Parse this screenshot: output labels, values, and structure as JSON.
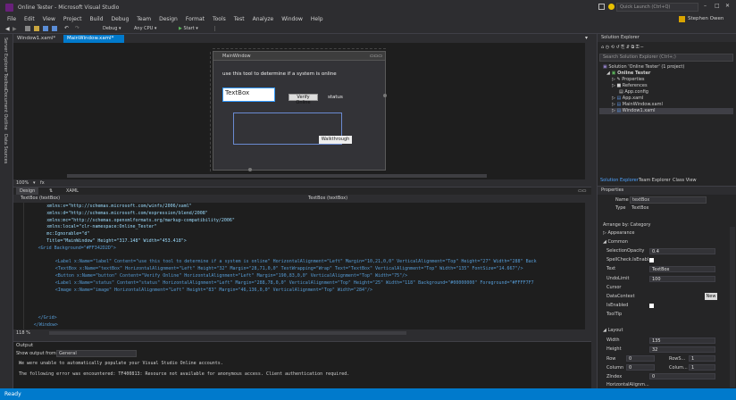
{
  "window": {
    "title": "Online Tester - Microsoft Visual Studio",
    "quick_launch": "Quick Launch (Ctrl+Q)",
    "user": "Stephen Owen"
  },
  "menu": [
    "File",
    "Edit",
    "View",
    "Project",
    "Build",
    "Debug",
    "Team",
    "Design",
    "Format",
    "Tools",
    "Test",
    "Analyze",
    "Window",
    "Help"
  ],
  "toolbar": {
    "config": "Debug",
    "platform": "Any CPU",
    "start": "Start"
  },
  "doc_tabs": [
    "Window1.xaml*",
    "MainWindow.xaml*"
  ],
  "left_strip": [
    "Server Explorer",
    "Toolbox",
    "Document Outline",
    "Data Sources"
  ],
  "designer": {
    "window_title": "MainWindow",
    "label_text": "use this tool to determine if a system is online",
    "textbox_text": "TextBox",
    "verify_button": "Verify Online",
    "status_label": "status",
    "walkthrough_label": "Walkthrough"
  },
  "zoom": "100%",
  "split_tabs": {
    "design": "Design",
    "xaml": "XAML"
  },
  "xaml_path": {
    "left": "TextBox (textBox)",
    "right": "TextBox (textBox)"
  },
  "code_lines": [
    "xmlns:x=\"http://schemas.microsoft.com/winfx/2006/xaml\"",
    "xmlns:d=\"http://schemas.microsoft.com/expression/blend/2008\"",
    "xmlns:mc=\"http://schemas.openxmlformats.org/markup-compatibility/2006\"",
    "xmlns:local=\"clr-namespace:Online_Tester\"",
    "mc:Ignorable=\"d\"",
    "Title=\"MainWindow\" Height=\"317.148\" Width=\"453.418\">",
    "<Grid Background=\"#FF342D2D\">",
    "",
    "<Label x:Name=\"label\" Content=\"use this tool to determine if a system is online\" HorizontalAlignment=\"Left\" Margin=\"10,21,0,0\" VerticalAlignment=\"Top\" Height=\"27\" Width=\"288\" Back",
    "<TextBox x:Name=\"textBox\" HorizontalAlignment=\"Left\" Height=\"32\" Margin=\"28,71,0,0\" TextWrapping=\"Wrap\" Text=\"TextBox\" VerticalAlignment=\"Top\" Width=\"135\" FontSize=\"14.667\"/>",
    "<Button x:Name=\"button\" Content=\"Verify Online\" HorizontalAlignment=\"Left\" Margin=\"190,83,0,0\" VerticalAlignment=\"Top\" Width=\"75\"/>",
    "<Label x:Name=\"status\" Content=\"status\" HorizontalAlignment=\"Left\" Margin=\"288,78,0,0\" VerticalAlignment=\"Top\" Height=\"25\" Width=\"118\" Background=\"#00000000\" Foreground=\"#FFFF7F7",
    "<Image x:Name=\"image\" HorizontalAlignment=\"Left\" Height=\"83\" Margin=\"46,136,0,0\" VerticalAlignment=\"Top\" Width=\"284\"/>",
    "",
    "",
    "",
    "</Grid>",
    "</Window>"
  ],
  "code_zoom": "118 %",
  "output": {
    "title": "Output",
    "show_from_label": "Show output from:",
    "source": "General",
    "lines": [
      "We were unable to automatically populate your Visual Studio Online accounts.",
      "",
      "The following error was encountered: TF400813: Resource not available for anonymous access. Client authentication required."
    ]
  },
  "status_bar": "Ready",
  "solution_explorer": {
    "title": "Solution Explorer",
    "search_placeholder": "Search Solution Explorer (Ctrl+;)",
    "items": [
      "Solution 'Online Tester' (1 project)",
      "Online Tester",
      "Properties",
      "References",
      "App.config",
      "App.xaml",
      "MainWindow.xaml",
      "Window1.xaml"
    ],
    "tabs": [
      "Solution Explorer",
      "Team Explorer",
      "Class View"
    ]
  },
  "properties": {
    "title": "Properties",
    "name_label": "Name",
    "name_value": "textBox",
    "type_label": "Type",
    "type_value": "TextBox",
    "arrange_by": "Arrange by: Category",
    "sections": [
      "Appearance",
      "Common",
      "Layout"
    ],
    "common_rows": [
      {
        "name": "SelectionOpacity",
        "value": "0.4"
      },
      {
        "name": "SpellCheck.IsEnabl...",
        "value": ""
      },
      {
        "name": "Text",
        "value": "TextBox"
      },
      {
        "name": "UndoLimit",
        "value": "100"
      },
      {
        "name": "Cursor",
        "value": ""
      },
      {
        "name": "DataContext",
        "value": ""
      },
      {
        "name": "IsEnabled",
        "value": ""
      },
      {
        "name": "ToolTip",
        "value": ""
      }
    ],
    "new_button": "New",
    "layout_rows": [
      {
        "name": "Width",
        "value": "135"
      },
      {
        "name": "Height",
        "value": "32"
      }
    ],
    "row_label": "Row",
    "row_value": "0",
    "rowspan_label": "RowS...",
    "rowspan_value": "1",
    "column_label": "Column",
    "column_value": "0",
    "colspan_label": "Colum...",
    "colspan_value": "1",
    "zindex_label": "ZIndex",
    "zindex_value": "0",
    "halign_label": "HorizontalAlignm..."
  }
}
